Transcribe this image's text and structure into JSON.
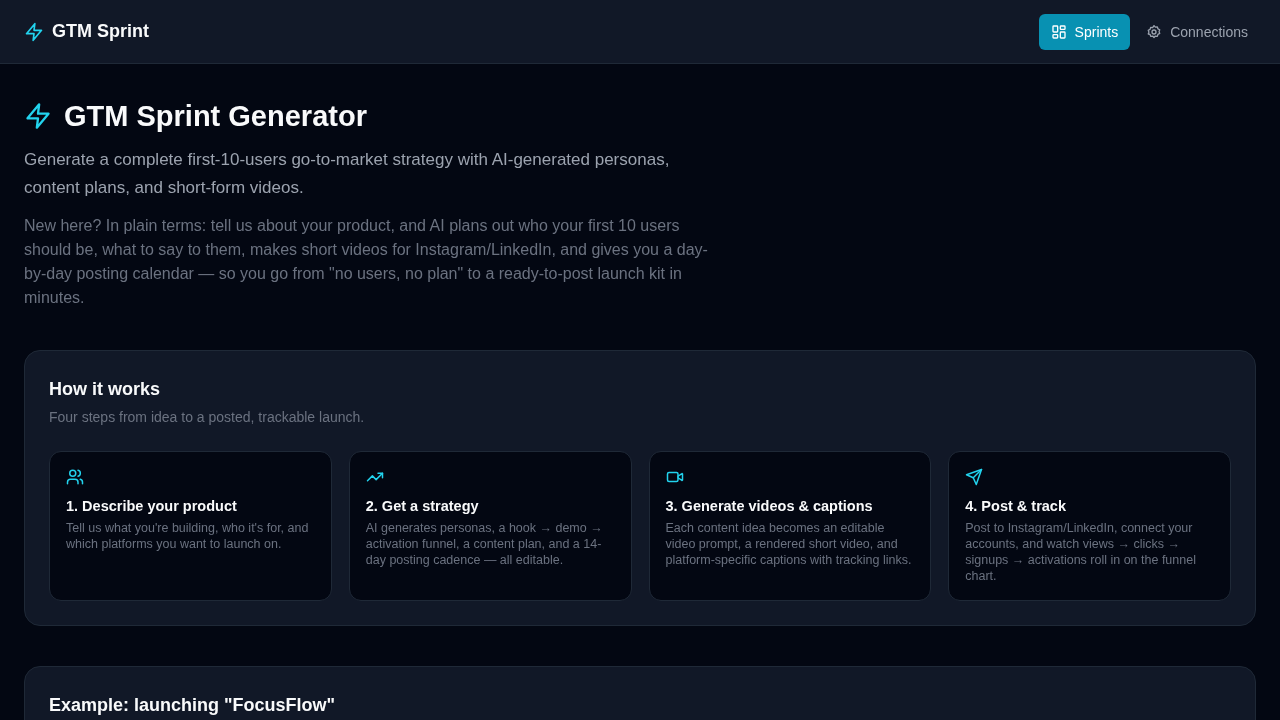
{
  "header": {
    "brand": "GTM Sprint",
    "nav": [
      {
        "label": "Sprints",
        "selected": true
      },
      {
        "label": "Connections",
        "selected": false
      }
    ]
  },
  "hero": {
    "title": "GTM Sprint Generator",
    "subtitle": "Generate a complete first-10-users go-to-market strategy with AI-generated personas, content plans, and short-form videos.",
    "intro": "New here? In plain terms: tell us about your product, and AI plans out who your first 10 users should be, what to say to them, makes short videos for Instagram/LinkedIn, and gives you a day-by-day posting calendar — so you go from \"no users, no plan\" to a ready-to-post launch kit in minutes."
  },
  "how_it_works": {
    "title": "How it works",
    "subtitle": "Four steps from idea to a posted, trackable launch.",
    "steps": [
      {
        "title": "1. Describe your product",
        "text": "Tell us what you're building, who it's for, and which platforms you want to launch on."
      },
      {
        "title": "2. Get a strategy",
        "text": "AI generates personas, a hook → demo → activation funnel, a content plan, and a 14-day posting cadence — all editable."
      },
      {
        "title": "3. Generate videos & captions",
        "text": "Each content idea becomes an editable video prompt, a rendered short video, and platform-specific captions with tracking links."
      },
      {
        "title": "4. Post & track",
        "text": "Post to Instagram/LinkedIn, connect your accounts, and watch views → clicks → signups → activations roll in on the funnel chart."
      }
    ]
  },
  "example": {
    "title": "Example: launching \"FocusFlow\""
  }
}
